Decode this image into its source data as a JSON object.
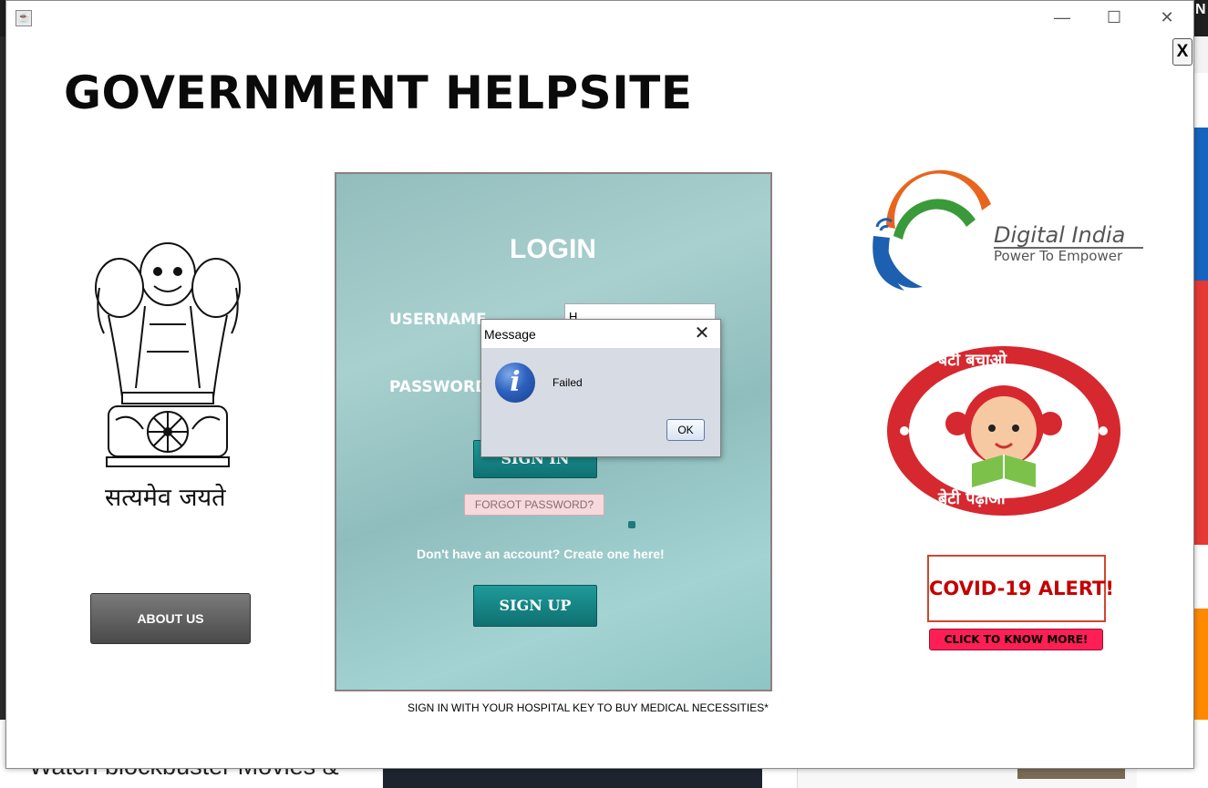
{
  "window": {
    "title": "",
    "controls": {
      "minimize": "—",
      "maximize": "☐",
      "close": "✕"
    },
    "java_icon": "java-icon"
  },
  "background": {
    "bottom_text": "Watch blockbuster Movies &",
    "right_letter": "N"
  },
  "app": {
    "close_x": "X",
    "title": "GOVERNMENT HELPSITE",
    "motto": "सत्यमेव जयते",
    "about_button": "ABOUT US"
  },
  "login": {
    "title": "LOGIN",
    "username_label": "USERNAME",
    "password_label": "PASSWORD",
    "username_value": "H",
    "sign_in": "SIGN IN",
    "forgot": "FORGOT PASSWORD?",
    "create_prompt": "Don't have an account? Create one here!",
    "sign_up": "SIGN UP",
    "footnote": "SIGN IN WITH YOUR HOSPITAL KEY TO BUY MEDICAL NECESSITIES*"
  },
  "digital_india": {
    "name": "Digital India",
    "tagline": "Power To Empower"
  },
  "beti_bachao": {
    "top_text": "बेटी बचाओ",
    "bottom_text": "बेटी पढ़ाओ"
  },
  "covid": {
    "alert": "COVID-19 ALERT!",
    "button": "CLICK TO KNOW MORE!"
  },
  "dialog": {
    "title": "Message",
    "close": "✕",
    "icon": "info-icon",
    "icon_glyph": "i",
    "message": "Failed",
    "ok": "OK"
  },
  "colors": {
    "teal_button": "#127f7f",
    "covid_red": "#c40000",
    "covid_button": "#ff1f55",
    "di_orange": "#e8651e",
    "di_green": "#3a9a3a",
    "di_blue": "#1d5fb0",
    "bb_red": "#d6282f"
  }
}
